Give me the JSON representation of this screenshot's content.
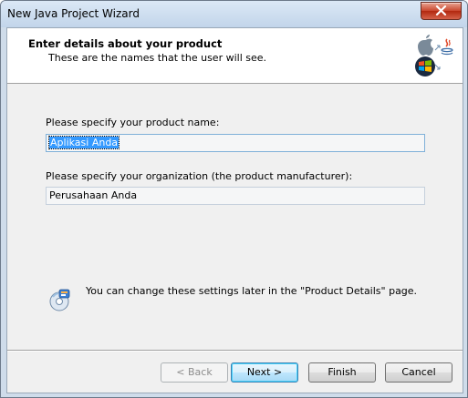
{
  "window": {
    "title": "New Java Project Wizard"
  },
  "header": {
    "title": "Enter details about your product",
    "subtitle": "These are the names that the user will see."
  },
  "form": {
    "product_name_label": "Please specify your product name:",
    "product_name_value": "Aplikasi Anda",
    "organization_label": "Please specify your organization (the product manufacturer):",
    "organization_value": "Perusahaan Anda"
  },
  "info": {
    "text": "You can change these settings later in the \"Product Details\" page."
  },
  "buttons": {
    "back": "< Back",
    "next": "Next >",
    "finish": "Finish",
    "cancel": "Cancel"
  },
  "colors": {
    "selection": "#3399ff",
    "default_button_border": "#3c7fb1",
    "close_button": "#c9452c"
  },
  "icons": [
    "close-icon",
    "apple-logo-icon",
    "java-logo-icon",
    "windows-logo-icon",
    "info-disc-icon"
  ]
}
